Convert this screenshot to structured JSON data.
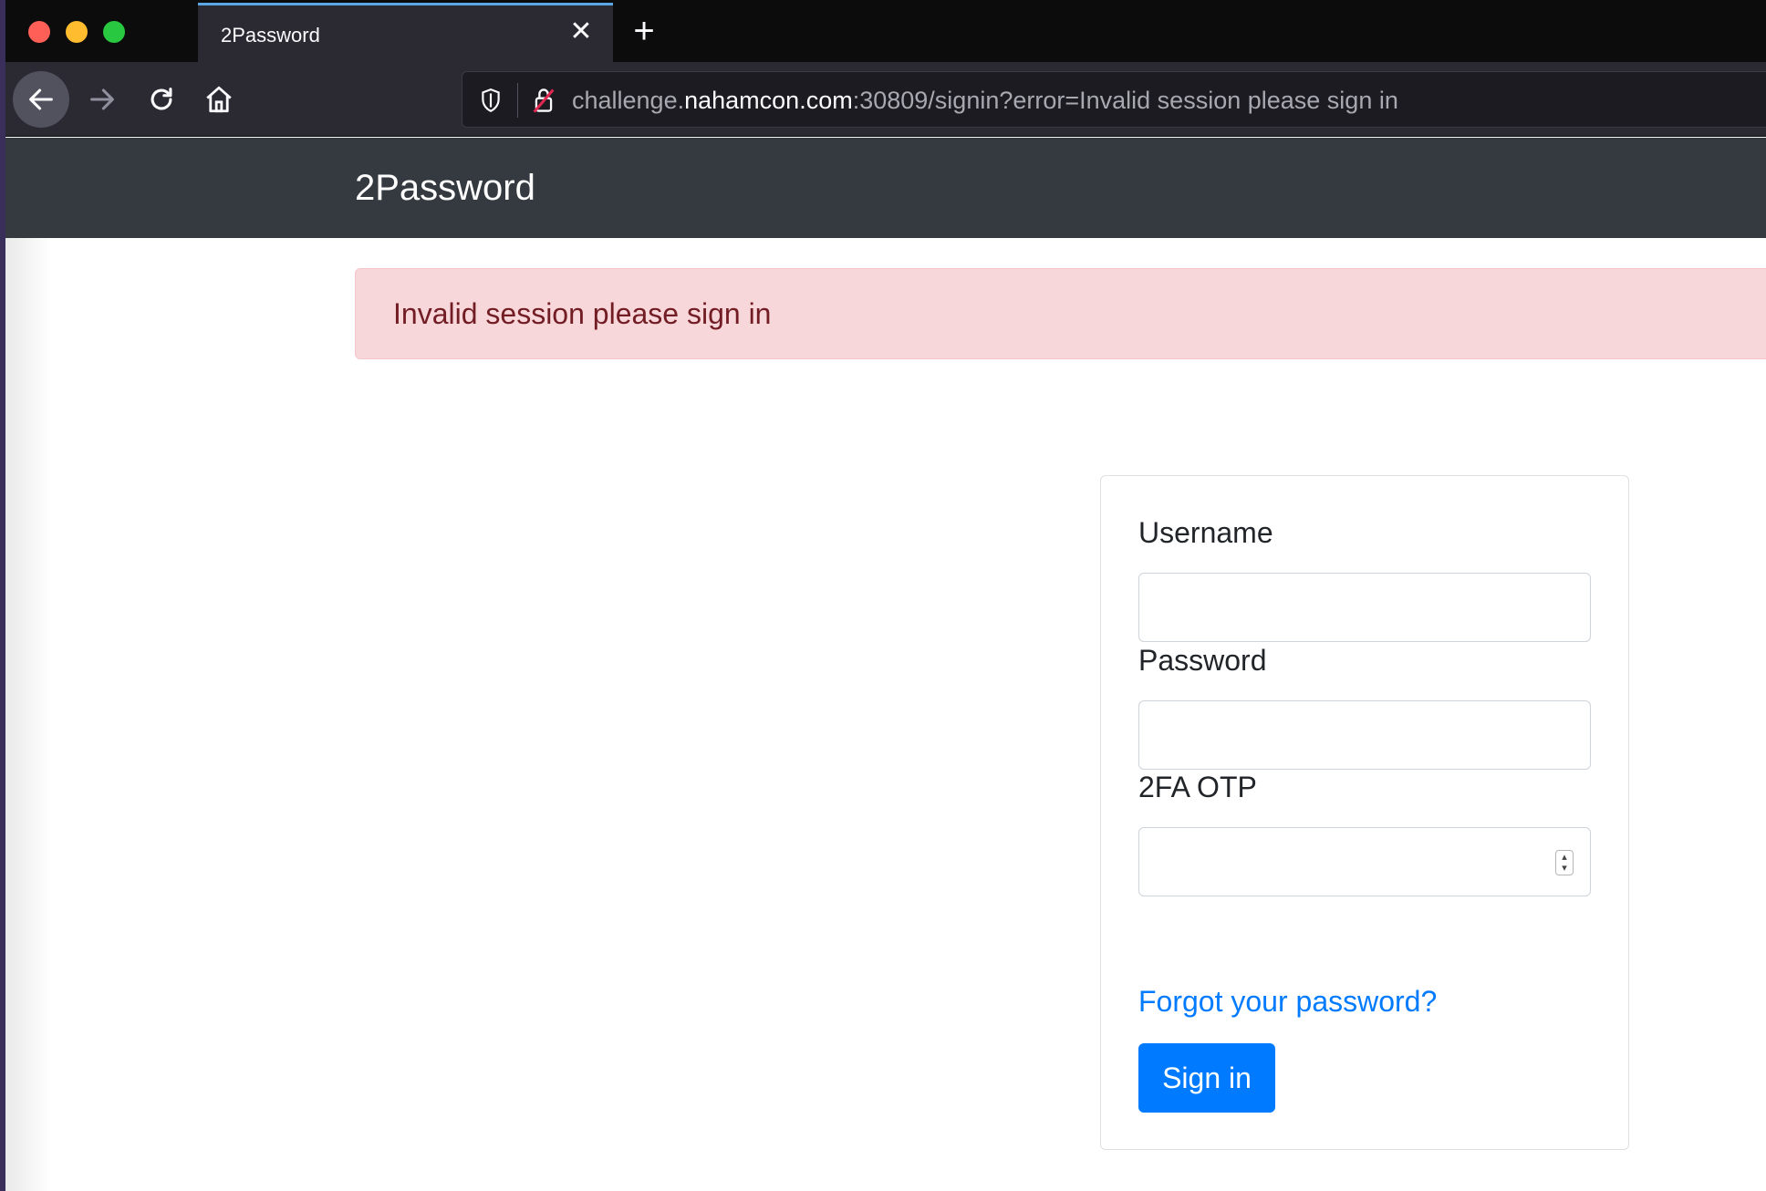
{
  "browser": {
    "tab": {
      "title": "2Password"
    },
    "url": {
      "prefix": "challenge.",
      "host": "nahamcon.com",
      "rest": ":30809/signin?error=Invalid session please sign in"
    }
  },
  "page": {
    "brand": "2Password",
    "alert": "Invalid session please sign in",
    "form": {
      "username_label": "Username",
      "username_value": "",
      "password_label": "Password",
      "password_value": "",
      "otp_label": "2FA OTP",
      "otp_value": "",
      "forgot_link": "Forgot your password?",
      "submit_label": "Sign in"
    }
  },
  "colors": {
    "navbar": "#343a40",
    "alert_bg": "#f8d7da",
    "alert_text": "#721c24",
    "primary": "#007bff"
  }
}
